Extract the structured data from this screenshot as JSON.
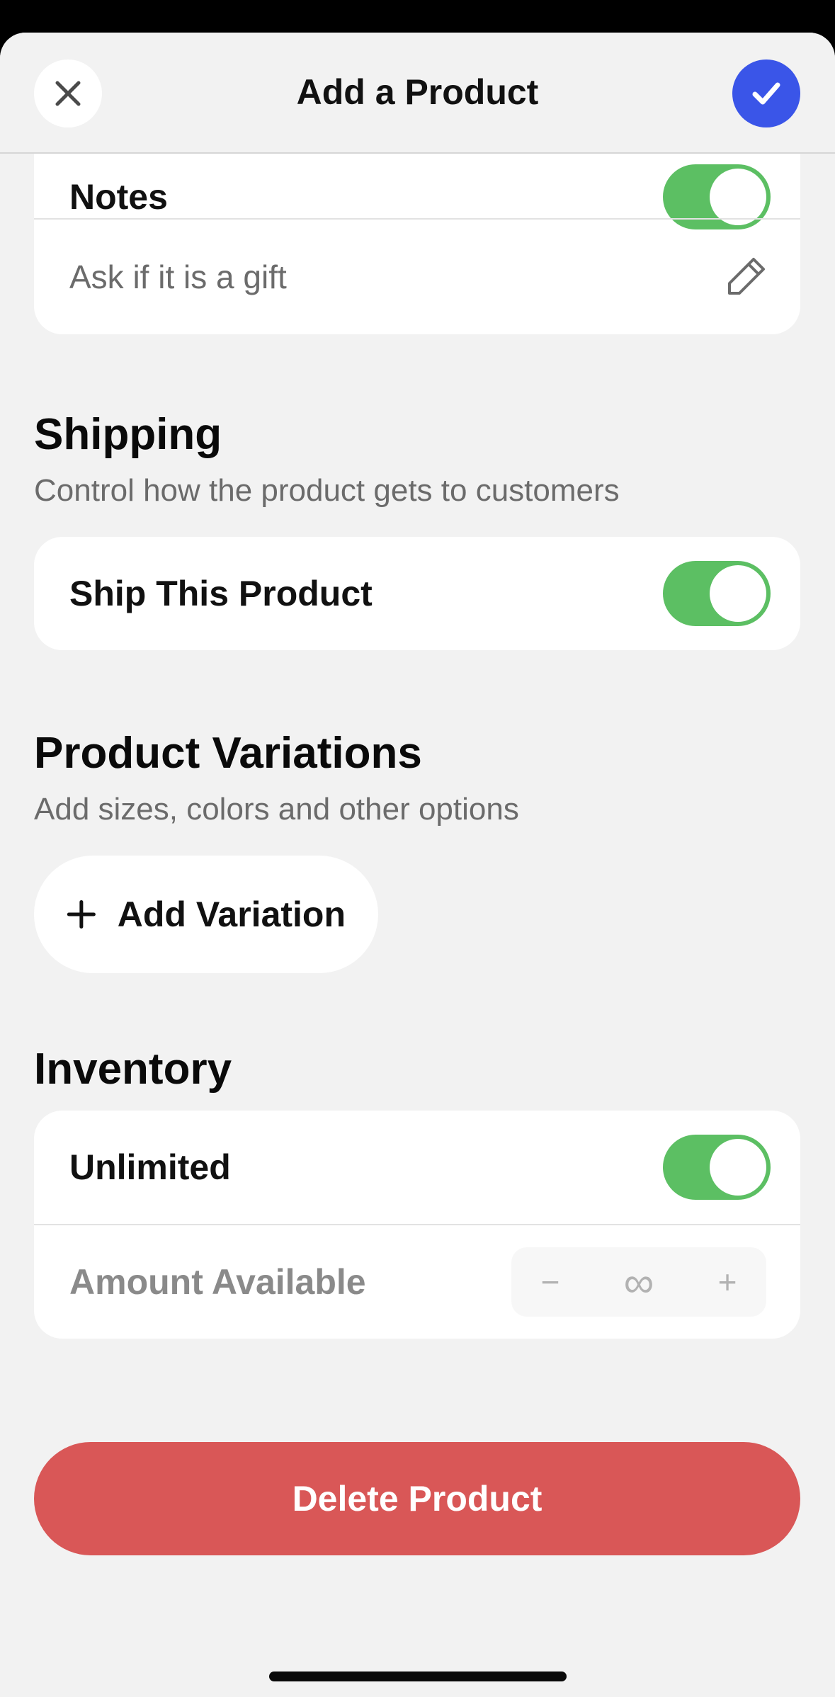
{
  "header": {
    "title": "Add a Product"
  },
  "notes": {
    "label": "Notes",
    "toggle_on": true,
    "prompt": "Ask if it is a gift"
  },
  "shipping": {
    "title": "Shipping",
    "subtitle": "Control how the product gets to customers",
    "ship_label": "Ship This Product",
    "toggle_on": true
  },
  "variations": {
    "title": "Product Variations",
    "subtitle": "Add sizes, colors and other options",
    "add_label": "Add Variation"
  },
  "inventory": {
    "title": "Inventory",
    "unlimited_label": "Unlimited",
    "unlimited_on": true,
    "amount_label": "Amount Available",
    "decrement_symbol": "−",
    "amount_value": "∞",
    "increment_symbol": "+"
  },
  "actions": {
    "delete_label": "Delete Product"
  },
  "colors": {
    "accent": "#3a55e8",
    "toggle_on": "#5cbf63",
    "danger": "#d95757",
    "background": "#f2f2f2"
  },
  "icons": {
    "close": "close-icon",
    "confirm": "checkmark-icon",
    "edit": "pencil-icon",
    "add": "plus-icon"
  }
}
